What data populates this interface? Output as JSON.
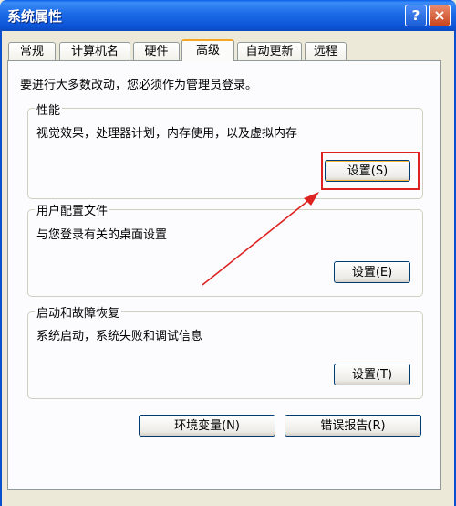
{
  "window": {
    "title": "系统属性",
    "help_icon": "?",
    "close_icon": "×"
  },
  "tabs": [
    {
      "label": "常规"
    },
    {
      "label": "计算机名"
    },
    {
      "label": "硬件"
    },
    {
      "label": "高级",
      "active": true
    },
    {
      "label": "自动更新"
    },
    {
      "label": "远程"
    }
  ],
  "intro": "要进行大多数改动，您必须作为管理员登录。",
  "performance": {
    "title": "性能",
    "description": "视觉效果，处理器计划，内存使用，以及虚拟内存",
    "button": "设置(S)"
  },
  "user_profiles": {
    "title": "用户配置文件",
    "description": "与您登录有关的桌面设置",
    "button": "设置(E)"
  },
  "startup_recovery": {
    "title": "启动和故障恢复",
    "description": "系统启动，系统失败和调试信息",
    "button": "设置(T)"
  },
  "buttons": {
    "env_vars": "环境变量(N)",
    "error_report": "错误报告(R)"
  },
  "colors": {
    "annotation": "#d22222",
    "titlebar": "#0b54d6"
  }
}
